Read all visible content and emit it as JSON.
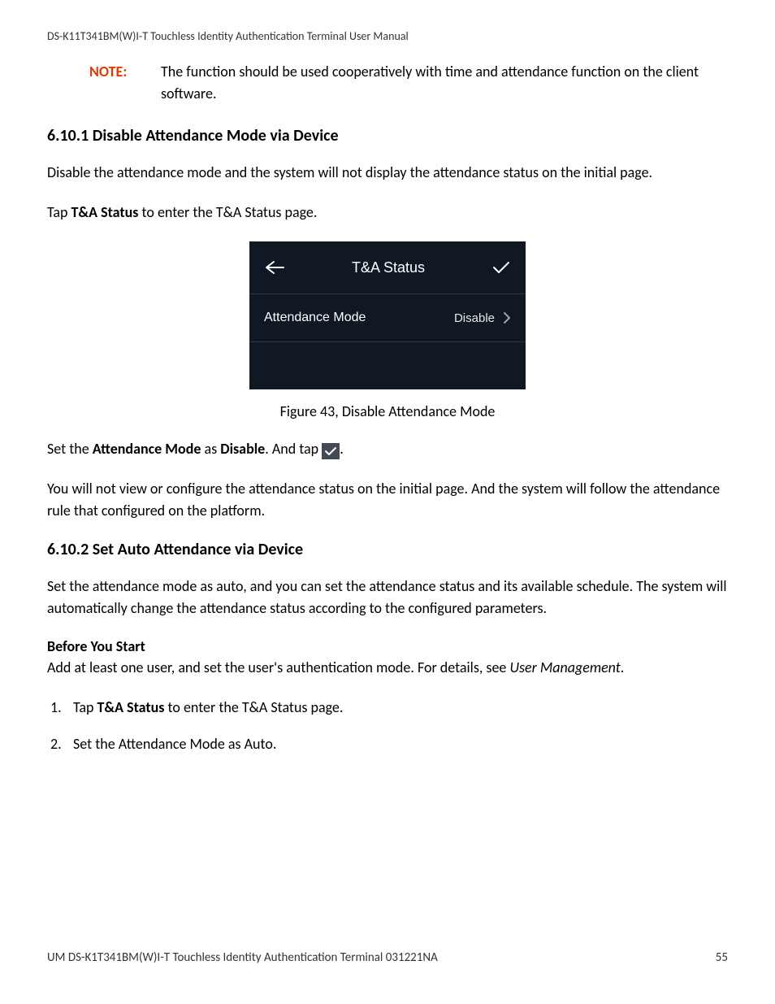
{
  "doc_header": "DS-K11T341BM(W)I-T Touchless Identity Authentication Terminal User Manual",
  "note": {
    "label": "NOTE:",
    "text": "The function should be used cooperatively with time and attendance function on the client software."
  },
  "section1": {
    "heading": "6.10.1 Disable Attendance Mode via Device",
    "p1": "Disable the attendance mode and the system will not display the attendance status on the initial page.",
    "p2_pre": "Tap ",
    "p2_bold": "T&A Status",
    "p2_post": " to enter the T&A Status page."
  },
  "figure43": {
    "header_title": "T&A Status",
    "row_label": "Attendance Mode",
    "row_value": "Disable",
    "caption": "Figure 43, Disable Attendance Mode"
  },
  "after_fig": {
    "pre": "Set the ",
    "b1": "Attendance Mode",
    "mid": " as ",
    "b2": "Disable",
    "post1": ". And tap ",
    "post2": ".",
    "p4_a": "You will not view or configure the attendance status on the initial page. And the system will follow the attendance rule that configured on the platform."
  },
  "section2": {
    "heading": "6.10.2 Set Auto Attendance via Device",
    "p1": "Set the attendance mode as auto, and you can set the attendance status and its available schedule. The system will automatically change the attendance status according to the configured parameters.",
    "before_start": "Before You Start",
    "before_body_pre": "Add at least one user, and set the user's authentication mode. For details, see ",
    "before_body_italic": "User Management",
    "before_body_post": ".",
    "steps": [
      {
        "n": "1.",
        "pre": "Tap ",
        "bold": "T&A Status",
        "post": " to enter the T&A Status page."
      },
      {
        "n": "2.",
        "pre": "Set the Attendance Mode as Auto.",
        "bold": "",
        "post": ""
      }
    ]
  },
  "footer": {
    "left": "UM DS-K1T341BM(W)I-T Touchless Identity Authentication Terminal 031221NA",
    "right": "55"
  }
}
